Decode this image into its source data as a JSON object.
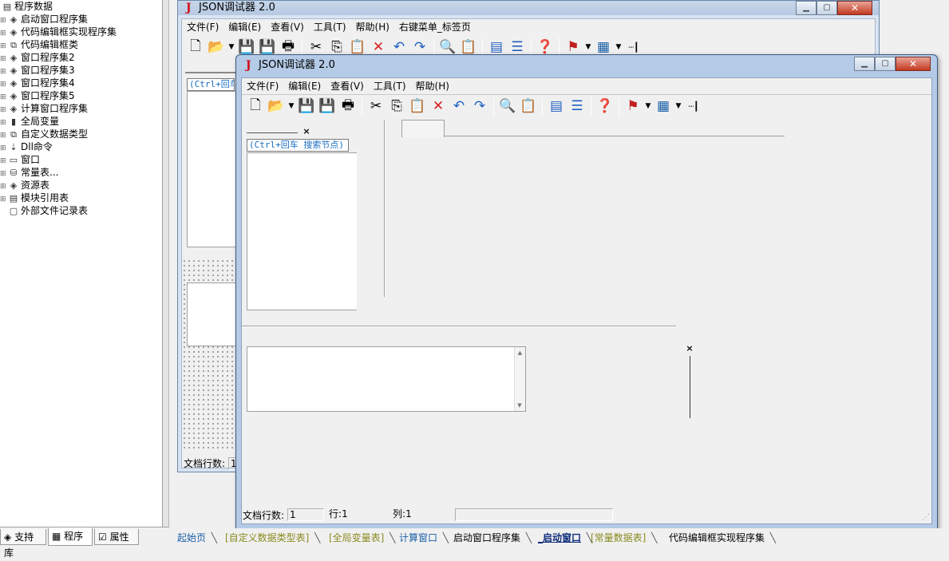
{
  "tree": {
    "root": "程序数据",
    "items": [
      {
        "label": "启动窗口程序集",
        "icon": "module-icon"
      },
      {
        "label": "代码编辑框实现程序集",
        "icon": "module-icon"
      },
      {
        "label": "代码编辑框类",
        "icon": "class-icon"
      },
      {
        "label": "窗口程序集2",
        "icon": "module-icon"
      },
      {
        "label": "窗口程序集3",
        "icon": "module-icon"
      },
      {
        "label": "窗口程序集4",
        "icon": "module-icon"
      },
      {
        "label": "窗口程序集5",
        "icon": "module-icon"
      },
      {
        "label": "计算窗口程序集",
        "icon": "module-icon"
      },
      {
        "label": "全局变量",
        "icon": "global-var-icon"
      },
      {
        "label": "自定义数据类型",
        "icon": "type-icon"
      },
      {
        "label": "Dll命令",
        "icon": "dll-icon"
      },
      {
        "label": "窗口",
        "icon": "window-icon"
      },
      {
        "label": "常量表...",
        "icon": "constant-icon"
      },
      {
        "label": "资源表",
        "icon": "resource-icon"
      },
      {
        "label": "模块引用表",
        "icon": "module-ref-icon"
      },
      {
        "label": "外部文件记录表",
        "icon": "file-record-icon"
      }
    ]
  },
  "left_tabs": {
    "support": "支持库",
    "program": "程序",
    "properties": "属性"
  },
  "back_window": {
    "title": "JSON调试器 2.0",
    "menu": [
      "文件(F)",
      "编辑(E)",
      "查看(V)",
      "工具(T)",
      "帮助(H)",
      "右键菜单_标签页"
    ],
    "search_hint": "(Ctrl+回车",
    "status_label": "文档行数:",
    "status_value": "1"
  },
  "front_window": {
    "title": "JSON调试器 2.0",
    "menu": [
      "文件(F)",
      "编辑(E)",
      "查看(V)",
      "工具(T)",
      "帮助(H)"
    ],
    "search_hint": "(Ctrl+回车 搜索节点)",
    "status": {
      "lines_label": "文档行数:",
      "lines_value": "1",
      "row_label": "行:",
      "row_value": "1",
      "col_label": "列:",
      "col_value": "1"
    }
  },
  "doc_tabs": [
    {
      "label": "起始页",
      "color": "#1a5ea8",
      "active": false
    },
    {
      "label": "[自定义数据类型表]",
      "color": "#8a8a20",
      "active": false
    },
    {
      "label": "[全局变量表]",
      "color": "#8a8a20",
      "active": false
    },
    {
      "label": "计算窗口",
      "color": "#1a5ea8",
      "active": false
    },
    {
      "label": "启动窗口程序集",
      "color": "#000000",
      "active": false
    },
    {
      "label": "_启动窗口",
      "color": "#0d2b7a",
      "active": true
    },
    {
      "label": "[常量数据表]",
      "color": "#8a8a20",
      "active": false
    },
    {
      "label": "代码编辑框实现程序集",
      "color": "#000000",
      "active": false
    }
  ],
  "colors": {
    "title_bar": "#b4cae6",
    "close_button": "#c33a20",
    "link_blue": "#1a6dbf"
  }
}
